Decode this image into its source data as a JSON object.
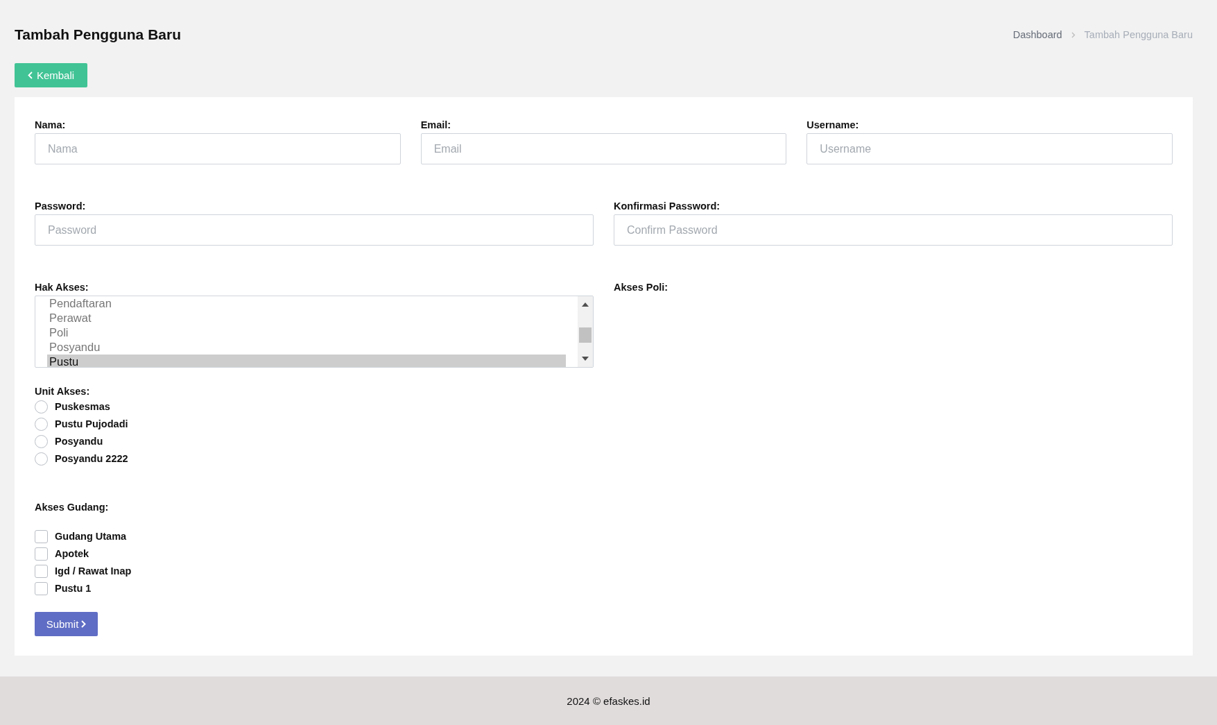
{
  "header": {
    "title": "Tambah Pengguna Baru",
    "breadcrumb": [
      {
        "label": "Dashboard",
        "current": false
      },
      {
        "label": "Tambah Pengguna Baru",
        "current": true
      }
    ]
  },
  "back_button": {
    "label": "Kembali"
  },
  "row_1": [
    {
      "label": "Nama:",
      "placeholder": "Nama"
    },
    {
      "label": "Email:",
      "placeholder": "Email"
    },
    {
      "label": "Username:",
      "placeholder": "Username"
    }
  ],
  "row_2": [
    {
      "label": "Password:",
      "placeholder": "Password"
    },
    {
      "label": "Konfirmasi Password:",
      "placeholder": "Confirm Password"
    }
  ],
  "hak_akses": {
    "label": "Hak Akses:",
    "options": [
      {
        "label": "Pendaftaran",
        "selected": false
      },
      {
        "label": "Perawat",
        "selected": false
      },
      {
        "label": "Poli",
        "selected": false
      },
      {
        "label": "Posyandu",
        "selected": false
      },
      {
        "label": "Pustu",
        "selected": true
      }
    ]
  },
  "akses_poli": {
    "label": "Akses Poli:"
  },
  "unit_akses": {
    "label": "Unit Akses:",
    "options": [
      {
        "label": "Puskesmas",
        "selected": false
      },
      {
        "label": "Pustu Pujodadi",
        "selected": false
      },
      {
        "label": "Posyandu",
        "selected": false
      },
      {
        "label": "Posyandu 2222",
        "selected": false
      }
    ]
  },
  "akses_gudang": {
    "label": "Akses Gudang:",
    "options": [
      {
        "label": "Gudang Utama",
        "checked": false
      },
      {
        "label": "Apotek",
        "checked": false
      },
      {
        "label": "Igd / Rawat Inap",
        "checked": false
      },
      {
        "label": "Pustu 1",
        "checked": false
      }
    ]
  },
  "submit_button": {
    "label": "Submit"
  },
  "footer": {
    "text": "2024 © efaskes.id"
  }
}
